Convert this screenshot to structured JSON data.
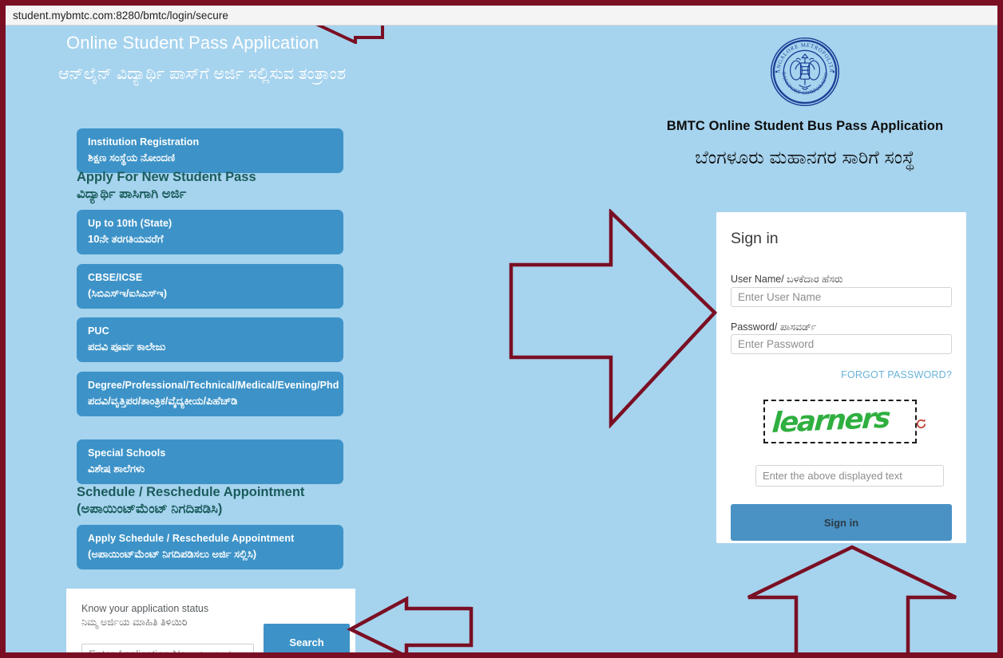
{
  "browser": {
    "url": "student.mybmtc.com:8280/bmtc/login/secure"
  },
  "colors": {
    "page_background": "#a6d3ee",
    "button_blue": "#3d93c8",
    "heading_teal": "#1a5c5c",
    "annotation_maroon": "#7a0f23",
    "captcha_green": "#2faf3f",
    "link_blue": "#69b3da"
  },
  "left": {
    "app_title_en": "Online Student Pass Application",
    "app_title_kn": "ಆನ್‌ಲೈನ್ ವಿದ್ಯಾರ್ಥಿ ಪಾಸ್‌ಗೆ ಅರ್ಜಿ ಸಲ್ಲಿಸುವ ತಂತ್ರಾಂಶ",
    "institution_button": {
      "en": "Institution Registration",
      "kn": "ಶಿಕ್ಷಣ ಸಂಸ್ಥೆಯ ನೋಂದಣಿ"
    },
    "apply_heading": {
      "en": "Apply For New Student Pass",
      "kn": "ವಿದ್ಯಾರ್ಥಿ ಪಾಸಿಗಾಗಿ ಅರ್ಜಿ"
    },
    "pass_buttons": [
      {
        "en": "Up to 10th (State)",
        "kn": "10ನೇ ತರಗತಿಯವರೆಗೆ"
      },
      {
        "en": "CBSE/ICSE",
        "kn": "(ಸಿಬಿಎಸ್‌ಇ/ಐಸಿಎಸ್‌ಇ)"
      },
      {
        "en": "PUC",
        "kn": "ಪದವಿ ಪೂರ್ವ ಕಾಲೇಜು"
      },
      {
        "en": "Degree/Professional/Technical/Medical/Evening/Phd",
        "kn": "ಪದವಿ/ವೃತ್ತಿಪರ/ತಾಂತ್ರಿಕ/ವೈದ್ಯಕೀಯ/ಪಿಹೆಚ್‌ಡಿ"
      },
      {
        "en": "Special Schools",
        "kn": "ವಿಶೇಷ ಶಾಲೆಗಳು"
      }
    ],
    "schedule_heading": {
      "en": "Schedule / Reschedule Appointment",
      "kn": "(ಅಪಾಯಿಂಟ್‌ಮೆಂಟ್ ನಿಗದಿಪಡಿಸಿ)"
    },
    "schedule_button": {
      "en": "Apply Schedule / Reschedule Appointment",
      "kn": "(ಅಪಾಯಿಂಟ್‌ಮೆಂಟ್ ನಿಗದಿಪಡಿಸಲು ಅರ್ಜಿ ಸಲ್ಲಿಸಿ)"
    },
    "status_card": {
      "label_en": "Know your application status",
      "label_kn": "ನಿಮ್ಮ ಅರ್ಜಿಯ ಮಾಹಿತಿ ತಿಳಿಯಿರಿ",
      "input_placeholder": "Enter Application No.ಅರ್ಜಿ ಸಂಖ್ಯೆ",
      "input_value": "",
      "search_label": "Search"
    }
  },
  "right": {
    "logo_alt": "bmtc-seal-logo",
    "logo_outer_text_top": "BANGALORE METROPOLITAN",
    "logo_outer_text_bottom": "TRANSPORT CORPORATION",
    "brand_title_en": "BMTC Online Student Bus Pass Application",
    "brand_title_kn": "ಬೆಂಗಳೂರು ಮಹಾನಗರ ಸಾರಿಗೆ ಸಂಸ್ಥೆ",
    "signin": {
      "title": "Sign in",
      "username_label": "User Name/ ಬಳಕೆದಾರ ಹೆಸರು",
      "username_placeholder": "Enter User Name",
      "username_value": "",
      "password_label": "Password/ ಪಾಸವರ್ಡ್",
      "password_placeholder": "Enter Password",
      "password_value": "",
      "forgot_password": "FORGOT PASSWORD?",
      "captcha_text": "learners",
      "captcha_refresh_icon": "refresh-icon",
      "captcha_placeholder": "Enter the above displayed text",
      "captcha_value": "",
      "submit_label": "Sign in"
    }
  },
  "annotations": {
    "url_arrow": "arrow-left-pointing-at-url-bar",
    "center_arrow": "arrow-right-pointing-at-signin-card",
    "search_arrow": "arrow-left-pointing-at-search-button",
    "signin_arrow": "arrow-up-pointing-at-signin-button"
  }
}
